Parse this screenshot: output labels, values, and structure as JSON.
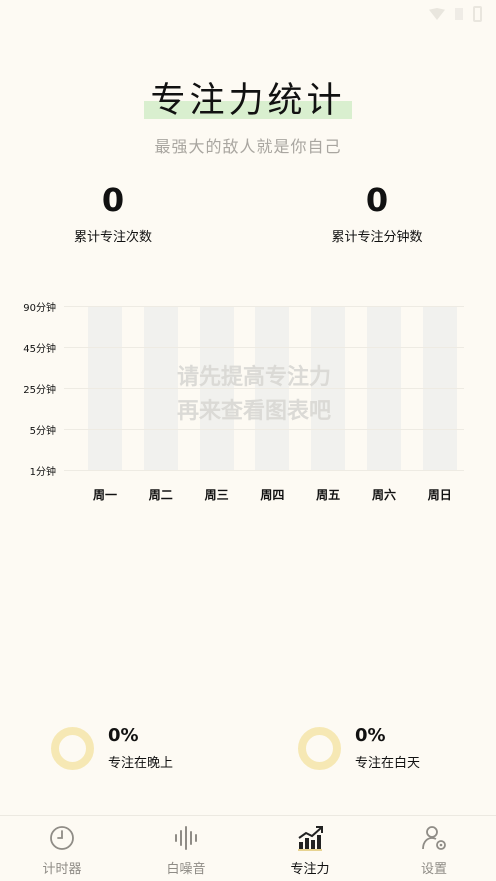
{
  "header": {
    "title": "专注力统计",
    "subtitle": "最强大的敌人就是你自己"
  },
  "stats": {
    "sessions_value": "0",
    "sessions_label": "累计专注次数",
    "minutes_value": "0",
    "minutes_label": "累计专注分钟数"
  },
  "chart_data": {
    "type": "bar",
    "categories": [
      "周一",
      "周二",
      "周三",
      "周四",
      "周五",
      "周六",
      "周日"
    ],
    "values": [
      0,
      0,
      0,
      0,
      0,
      0,
      0
    ],
    "y_ticks": [
      "90分钟",
      "45分钟",
      "25分钟",
      "5分钟",
      "1分钟"
    ],
    "empty_message_line1": "请先提高专注力",
    "empty_message_line2": "再来查看图表吧"
  },
  "rings": {
    "night_pct": "0%",
    "night_label": "专注在晚上",
    "day_pct": "0%",
    "day_label": "专注在白天",
    "ring_color": "#f6e8b4"
  },
  "nav": {
    "items": [
      {
        "label": "计时器",
        "icon": "clock-icon"
      },
      {
        "label": "白噪音",
        "icon": "soundwave-icon"
      },
      {
        "label": "专注力",
        "icon": "chart-trend-icon"
      },
      {
        "label": "设置",
        "icon": "user-settings-icon"
      }
    ],
    "active_index": 2
  }
}
